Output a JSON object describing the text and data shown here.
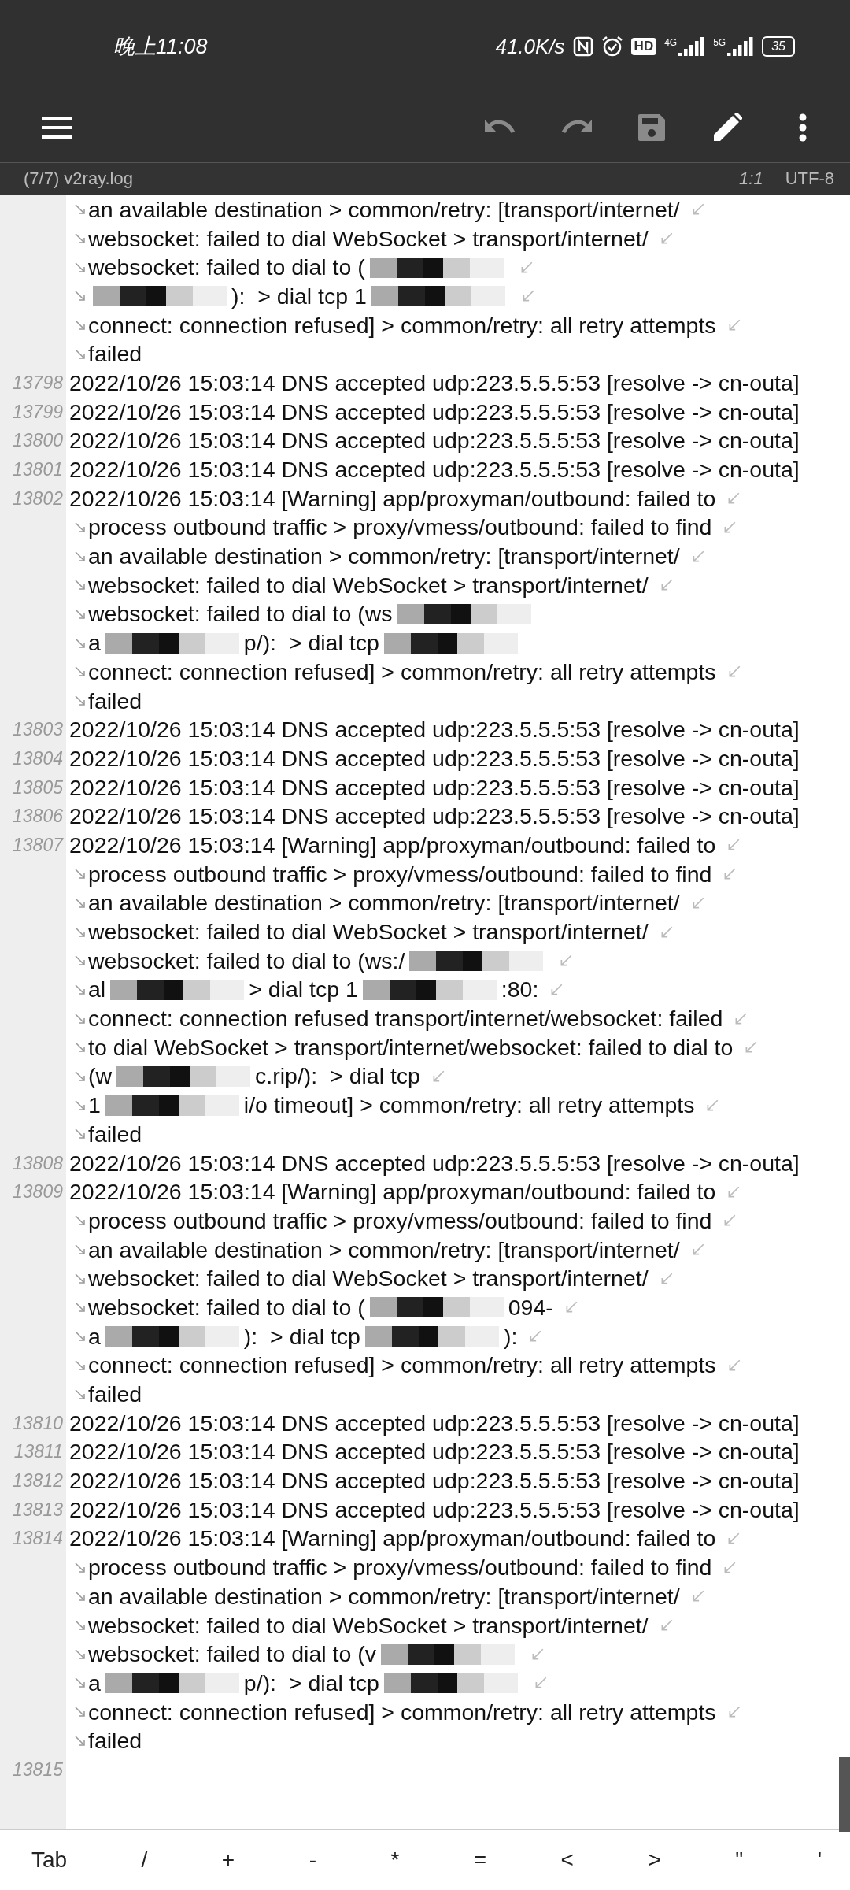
{
  "status_bar": {
    "time": "晚上11:08",
    "speed": "41.0K/s",
    "icons": [
      {
        "kind": "nfc"
      },
      {
        "kind": "alarm"
      },
      {
        "kind": "hd",
        "text": "HD"
      },
      {
        "kind": "signal",
        "label": "4G"
      },
      {
        "kind": "signal",
        "label": "5G"
      }
    ],
    "battery": "35"
  },
  "toolbar": {
    "actions": [
      {
        "kind": "undo",
        "disabled": true
      },
      {
        "kind": "redo",
        "disabled": true
      },
      {
        "kind": "save",
        "disabled": true
      },
      {
        "kind": "edit",
        "disabled": false
      },
      {
        "kind": "more",
        "disabled": false
      }
    ]
  },
  "file_bar": {
    "name": "(7/7) v2ray.log",
    "position": "1:1",
    "encoding": "UTF-8"
  },
  "rows": [
    {
      "continued": true,
      "wraps": true,
      "segments": [
        {
          "kind": "text",
          "text": "an available destination > common/retry: [transport/internet/"
        }
      ]
    },
    {
      "continued": true,
      "wraps": true,
      "segments": [
        {
          "kind": "text",
          "text": "websocket: failed to dial WebSocket > transport/internet/"
        }
      ]
    },
    {
      "continued": true,
      "wraps": true,
      "segments": [
        {
          "kind": "text",
          "text": "websocket: failed to dial to ("
        },
        {
          "kind": "redacted"
        }
      ]
    },
    {
      "continued": true,
      "wraps": true,
      "segments": [
        {
          "kind": "redacted"
        },
        {
          "kind": "text",
          "text": "):  > dial tcp 1"
        },
        {
          "kind": "redacted"
        }
      ]
    },
    {
      "continued": true,
      "wraps": true,
      "segments": [
        {
          "kind": "text",
          "text": "connect: connection refused] > common/retry: all retry attempts"
        }
      ]
    },
    {
      "continued": true,
      "wraps": false,
      "segments": [
        {
          "kind": "text",
          "text": "failed"
        }
      ]
    },
    {
      "number": "13798",
      "continued": false,
      "wraps": false,
      "segments": [
        {
          "kind": "text",
          "text": "2022/10/26 15:03:14 DNS accepted udp:223.5.5.5:53 [resolve -> cn-outa]"
        }
      ]
    },
    {
      "number": "13799",
      "continued": false,
      "wraps": false,
      "segments": [
        {
          "kind": "text",
          "text": "2022/10/26 15:03:14 DNS accepted udp:223.5.5.5:53 [resolve -> cn-outa]"
        }
      ]
    },
    {
      "number": "13800",
      "continued": false,
      "wraps": false,
      "segments": [
        {
          "kind": "text",
          "text": "2022/10/26 15:03:14 DNS accepted udp:223.5.5.5:53 [resolve -> cn-outa]"
        }
      ]
    },
    {
      "number": "13801",
      "continued": false,
      "wraps": false,
      "segments": [
        {
          "kind": "text",
          "text": "2022/10/26 15:03:14 DNS accepted udp:223.5.5.5:53 [resolve -> cn-outa]"
        }
      ]
    },
    {
      "number": "13802",
      "continued": false,
      "wraps": true,
      "segments": [
        {
          "kind": "text",
          "text": "2022/10/26 15:03:14 [Warning] app/proxyman/outbound: failed to"
        }
      ]
    },
    {
      "continued": true,
      "wraps": true,
      "segments": [
        {
          "kind": "text",
          "text": "process outbound traffic > proxy/vmess/outbound: failed to find"
        }
      ]
    },
    {
      "continued": true,
      "wraps": true,
      "segments": [
        {
          "kind": "text",
          "text": "an available destination > common/retry: [transport/internet/"
        }
      ]
    },
    {
      "continued": true,
      "wraps": true,
      "segments": [
        {
          "kind": "text",
          "text": "websocket: failed to dial WebSocket > transport/internet/"
        }
      ]
    },
    {
      "continued": true,
      "wraps": false,
      "segments": [
        {
          "kind": "text",
          "text": "websocket: failed to dial to (ws"
        },
        {
          "kind": "redacted"
        }
      ]
    },
    {
      "continued": true,
      "wraps": false,
      "segments": [
        {
          "kind": "text",
          "text": "a"
        },
        {
          "kind": "redacted"
        },
        {
          "kind": "text",
          "text": "p/):  > dial tcp"
        },
        {
          "kind": "redacted"
        }
      ]
    },
    {
      "continued": true,
      "wraps": true,
      "segments": [
        {
          "kind": "text",
          "text": "connect: connection refused] > common/retry: all retry attempts"
        }
      ]
    },
    {
      "continued": true,
      "wraps": false,
      "segments": [
        {
          "kind": "text",
          "text": "failed"
        }
      ]
    },
    {
      "number": "13803",
      "continued": false,
      "wraps": false,
      "segments": [
        {
          "kind": "text",
          "text": "2022/10/26 15:03:14 DNS accepted udp:223.5.5.5:53 [resolve -> cn-outa]"
        }
      ]
    },
    {
      "number": "13804",
      "continued": false,
      "wraps": false,
      "segments": [
        {
          "kind": "text",
          "text": "2022/10/26 15:03:14 DNS accepted udp:223.5.5.5:53 [resolve -> cn-outa]"
        }
      ]
    },
    {
      "number": "13805",
      "continued": false,
      "wraps": false,
      "segments": [
        {
          "kind": "text",
          "text": "2022/10/26 15:03:14 DNS accepted udp:223.5.5.5:53 [resolve -> cn-outa]"
        }
      ]
    },
    {
      "number": "13806",
      "continued": false,
      "wraps": false,
      "segments": [
        {
          "kind": "text",
          "text": "2022/10/26 15:03:14 DNS accepted udp:223.5.5.5:53 [resolve -> cn-outa]"
        }
      ]
    },
    {
      "number": "13807",
      "continued": false,
      "wraps": true,
      "segments": [
        {
          "kind": "text",
          "text": "2022/10/26 15:03:14 [Warning] app/proxyman/outbound: failed to"
        }
      ]
    },
    {
      "continued": true,
      "wraps": true,
      "segments": [
        {
          "kind": "text",
          "text": "process outbound traffic > proxy/vmess/outbound: failed to find"
        }
      ]
    },
    {
      "continued": true,
      "wraps": true,
      "segments": [
        {
          "kind": "text",
          "text": "an available destination > common/retry: [transport/internet/"
        }
      ]
    },
    {
      "continued": true,
      "wraps": true,
      "segments": [
        {
          "kind": "text",
          "text": "websocket: failed to dial WebSocket > transport/internet/"
        }
      ]
    },
    {
      "continued": true,
      "wraps": true,
      "segments": [
        {
          "kind": "text",
          "text": "websocket: failed to dial to (ws:/"
        },
        {
          "kind": "redacted"
        }
      ]
    },
    {
      "continued": true,
      "wraps": true,
      "segments": [
        {
          "kind": "text",
          "text": "al"
        },
        {
          "kind": "redacted"
        },
        {
          "kind": "text",
          "text": "> dial tcp 1"
        },
        {
          "kind": "redacted"
        },
        {
          "kind": "text",
          "text": ":80:"
        }
      ]
    },
    {
      "continued": true,
      "wraps": true,
      "segments": [
        {
          "kind": "text",
          "text": "connect: connection refused transport/internet/websocket: failed"
        }
      ]
    },
    {
      "continued": true,
      "wraps": true,
      "segments": [
        {
          "kind": "text",
          "text": "to dial WebSocket > transport/internet/websocket: failed to dial to"
        }
      ]
    },
    {
      "continued": true,
      "wraps": true,
      "segments": [
        {
          "kind": "text",
          "text": "(w"
        },
        {
          "kind": "redacted"
        },
        {
          "kind": "text",
          "text": "c.rip/):  > dial tcp"
        }
      ]
    },
    {
      "continued": true,
      "wraps": true,
      "segments": [
        {
          "kind": "text",
          "text": "1"
        },
        {
          "kind": "redacted"
        },
        {
          "kind": "text",
          "text": "i/o timeout] > common/retry: all retry attempts"
        }
      ]
    },
    {
      "continued": true,
      "wraps": false,
      "segments": [
        {
          "kind": "text",
          "text": "failed"
        }
      ]
    },
    {
      "number": "13808",
      "continued": false,
      "wraps": false,
      "segments": [
        {
          "kind": "text",
          "text": "2022/10/26 15:03:14 DNS accepted udp:223.5.5.5:53 [resolve -> cn-outa]"
        }
      ]
    },
    {
      "number": "13809",
      "continued": false,
      "wraps": true,
      "segments": [
        {
          "kind": "text",
          "text": "2022/10/26 15:03:14 [Warning] app/proxyman/outbound: failed to"
        }
      ]
    },
    {
      "continued": true,
      "wraps": true,
      "segments": [
        {
          "kind": "text",
          "text": "process outbound traffic > proxy/vmess/outbound: failed to find"
        }
      ]
    },
    {
      "continued": true,
      "wraps": true,
      "segments": [
        {
          "kind": "text",
          "text": "an available destination > common/retry: [transport/internet/"
        }
      ]
    },
    {
      "continued": true,
      "wraps": true,
      "segments": [
        {
          "kind": "text",
          "text": "websocket: failed to dial WebSocket > transport/internet/"
        }
      ]
    },
    {
      "continued": true,
      "wraps": true,
      "segments": [
        {
          "kind": "text",
          "text": "websocket: failed to dial to ("
        },
        {
          "kind": "redacted"
        },
        {
          "kind": "text",
          "text": "094-"
        }
      ]
    },
    {
      "continued": true,
      "wraps": true,
      "segments": [
        {
          "kind": "text",
          "text": "a"
        },
        {
          "kind": "redacted"
        },
        {
          "kind": "text",
          "text": "):  > dial tcp"
        },
        {
          "kind": "redacted"
        },
        {
          "kind": "text",
          "text": "):"
        }
      ]
    },
    {
      "continued": true,
      "wraps": true,
      "segments": [
        {
          "kind": "text",
          "text": "connect: connection refused] > common/retry: all retry attempts"
        }
      ]
    },
    {
      "continued": true,
      "wraps": false,
      "segments": [
        {
          "kind": "text",
          "text": "failed"
        }
      ]
    },
    {
      "number": "13810",
      "continued": false,
      "wraps": false,
      "segments": [
        {
          "kind": "text",
          "text": "2022/10/26 15:03:14 DNS accepted udp:223.5.5.5:53 [resolve -> cn-outa]"
        }
      ]
    },
    {
      "number": "13811",
      "continued": false,
      "wraps": false,
      "segments": [
        {
          "kind": "text",
          "text": "2022/10/26 15:03:14 DNS accepted udp:223.5.5.5:53 [resolve -> cn-outa]"
        }
      ]
    },
    {
      "number": "13812",
      "continued": false,
      "wraps": false,
      "segments": [
        {
          "kind": "text",
          "text": "2022/10/26 15:03:14 DNS accepted udp:223.5.5.5:53 [resolve -> cn-outa]"
        }
      ]
    },
    {
      "number": "13813",
      "continued": false,
      "wraps": false,
      "segments": [
        {
          "kind": "text",
          "text": "2022/10/26 15:03:14 DNS accepted udp:223.5.5.5:53 [resolve -> cn-outa]"
        }
      ]
    },
    {
      "number": "13814",
      "continued": false,
      "wraps": true,
      "segments": [
        {
          "kind": "text",
          "text": "2022/10/26 15:03:14 [Warning] app/proxyman/outbound: failed to"
        }
      ]
    },
    {
      "continued": true,
      "wraps": true,
      "segments": [
        {
          "kind": "text",
          "text": "process outbound traffic > proxy/vmess/outbound: failed to find"
        }
      ]
    },
    {
      "continued": true,
      "wraps": true,
      "segments": [
        {
          "kind": "text",
          "text": "an available destination > common/retry: [transport/internet/"
        }
      ]
    },
    {
      "continued": true,
      "wraps": true,
      "segments": [
        {
          "kind": "text",
          "text": "websocket: failed to dial WebSocket > transport/internet/"
        }
      ]
    },
    {
      "continued": true,
      "wraps": true,
      "segments": [
        {
          "kind": "text",
          "text": "websocket: failed to dial to (v"
        },
        {
          "kind": "redacted"
        }
      ]
    },
    {
      "continued": true,
      "wraps": true,
      "segments": [
        {
          "kind": "text",
          "text": "a"
        },
        {
          "kind": "redacted"
        },
        {
          "kind": "text",
          "text": "p/):  > dial tcp"
        },
        {
          "kind": "redacted"
        }
      ]
    },
    {
      "continued": true,
      "wraps": true,
      "segments": [
        {
          "kind": "text",
          "text": "connect: connection refused] > common/retry: all retry attempts"
        }
      ]
    },
    {
      "continued": true,
      "wraps": false,
      "segments": [
        {
          "kind": "text",
          "text": "failed"
        }
      ]
    },
    {
      "number": "13815",
      "continued": false,
      "wraps": false,
      "segments": []
    }
  ],
  "keys": [
    "Tab",
    "/",
    "+",
    "-",
    "*",
    "=",
    "<",
    ">",
    "\"",
    "'"
  ]
}
